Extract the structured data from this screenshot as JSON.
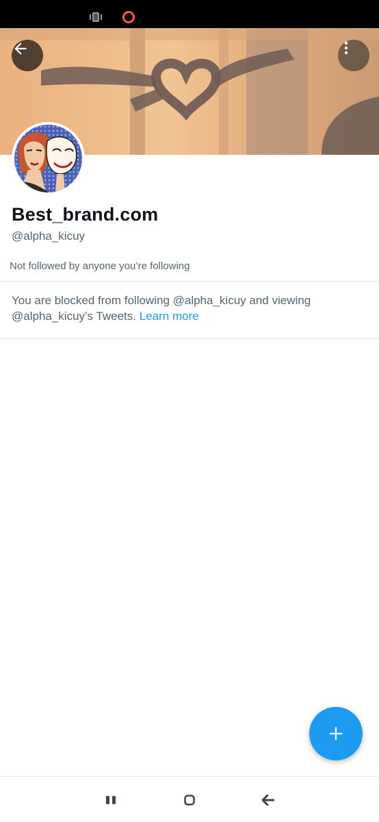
{
  "profile": {
    "display_name": "Best_brand.com",
    "handle": "@alpha_kicuy",
    "followers_context": "Not followed by anyone you’re following"
  },
  "blocked_notice": {
    "text": "You are blocked from following @alpha_kicuy and viewing @alpha_kicuy’s Tweets.",
    "link_label": "Learn more"
  },
  "icons": {
    "back": "arrow-left-icon",
    "more": "more-vertical-icon",
    "compose": "plus-icon",
    "status_vibrate": "vibrate-icon",
    "status_ring": "ring-icon",
    "nav_recents": "recents-icon",
    "nav_home": "home-icon",
    "nav_back": "nav-back-icon"
  },
  "colors": {
    "accent": "#1d9bf0",
    "secondary_text": "#536471",
    "primary_text": "#0f1419",
    "status_ring": "#ff5a36"
  }
}
